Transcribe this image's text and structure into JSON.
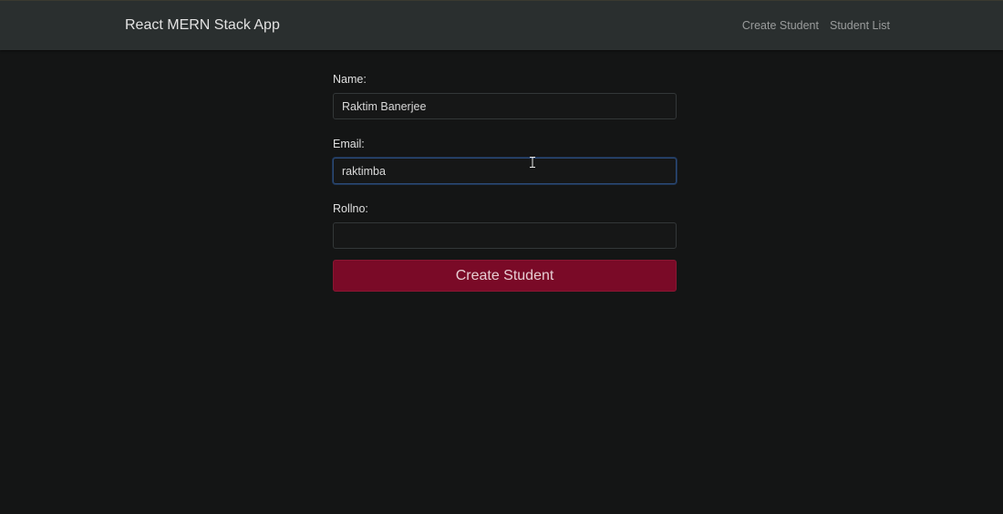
{
  "navbar": {
    "brand": "React MERN Stack App",
    "links": [
      {
        "label": "Create Student"
      },
      {
        "label": "Student List"
      }
    ]
  },
  "form": {
    "name": {
      "label": "Name:",
      "value": "Raktim Banerjee"
    },
    "email": {
      "label": "Email:",
      "value": "raktimba"
    },
    "rollno": {
      "label": "Rollno:",
      "value": ""
    },
    "submit_label": "Create Student"
  },
  "colors": {
    "navbar_bg": "#2a2f2f",
    "page_bg": "#141515",
    "button_bg": "#7a0a27",
    "focus_border": "#2c4a76"
  },
  "icons": {
    "text_cursor": "i-beam-cursor-icon"
  }
}
